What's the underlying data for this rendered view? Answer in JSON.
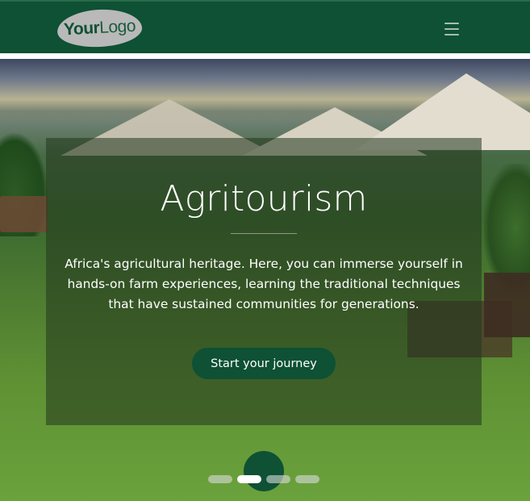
{
  "navbar": {
    "logo_part1": "Your",
    "logo_part2": "Logo",
    "menu_icon": "hamburger-menu-icon"
  },
  "hero": {
    "title": "Agritourism",
    "description": "Africa's agricultural heritage. Here, you can immerse yourself in hands-on farm experiences, learning the traditional techniques that have sustained communities for generations.",
    "cta_label": "Start your journey"
  },
  "carousel": {
    "slide_count": 4,
    "active_index": 1
  },
  "colors": {
    "brand_green": "#0e5134",
    "logo_bg": "#b9b9b9",
    "text_white": "#ffffff"
  }
}
